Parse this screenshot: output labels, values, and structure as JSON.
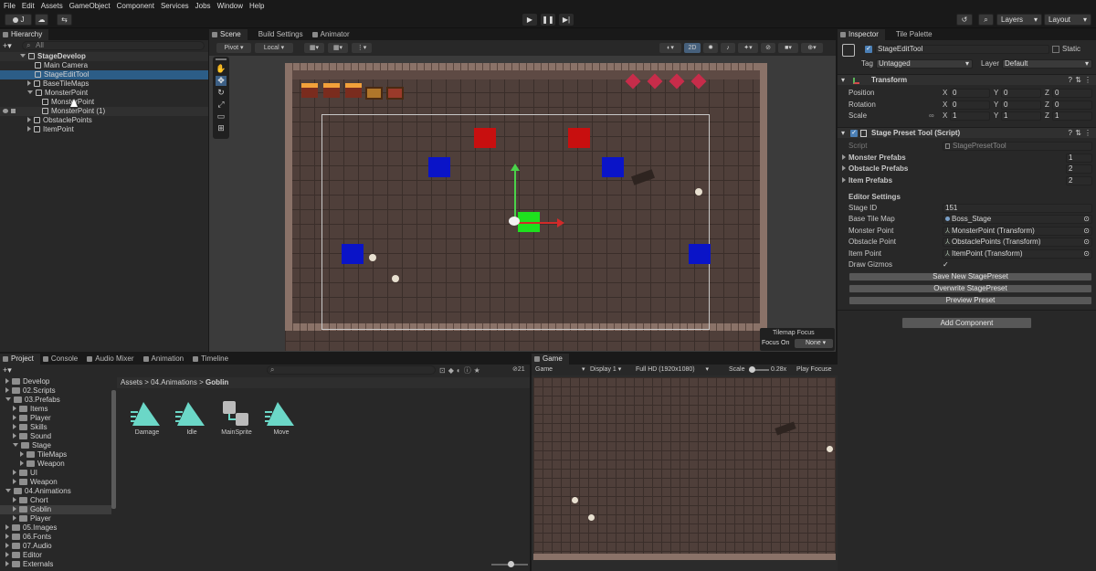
{
  "menu": [
    "File",
    "Edit",
    "Assets",
    "GameObject",
    "Component",
    "Services",
    "Jobs",
    "Window",
    "Help"
  ],
  "toolbar": {
    "account": "J",
    "layers": "Layers",
    "layout": "Layout"
  },
  "hierarchy": {
    "tab": "Hierarchy",
    "search_placeholder": "All",
    "scene": "StageDevelop",
    "items": [
      "Main Camera",
      "StageEditTool",
      "BaseTileMaps",
      "MonsterPoint",
      "MonsterPoint",
      "MonsterPoint (1)",
      "ObstaclePoints",
      "ItemPoint"
    ]
  },
  "scene_tabs": [
    "Scene",
    "Build Settings",
    "Animator"
  ],
  "scene_toolbar": {
    "pivot": "Pivot",
    "local": "Local",
    "mode2d": "2D"
  },
  "tilemap_focus": {
    "title": "Tilemap Focus",
    "label": "Focus On",
    "value": "None"
  },
  "inspector": {
    "tabs": [
      "Inspector",
      "Tile Palette"
    ],
    "object_name": "StageEditTool",
    "static_label": "Static",
    "tag_label": "Tag",
    "tag_value": "Untagged",
    "layer_label": "Layer",
    "layer_value": "Default",
    "transform": {
      "title": "Transform",
      "rows": [
        {
          "label": "Position",
          "x": "0",
          "y": "0",
          "z": "0"
        },
        {
          "label": "Rotation",
          "x": "0",
          "y": "0",
          "z": "0"
        },
        {
          "label": "Scale",
          "x": "1",
          "y": "1",
          "z": "1"
        }
      ]
    },
    "script_comp": {
      "title": "Stage Preset Tool (Script)",
      "script_label": "Script",
      "script_value": "StagePresetTool",
      "lists": [
        {
          "label": "Monster Prefabs",
          "value": "1"
        },
        {
          "label": "Obstacle Prefabs",
          "value": "2"
        },
        {
          "label": "Item Prefabs",
          "value": "2"
        }
      ],
      "editor_settings": "Editor Settings",
      "fields": [
        {
          "label": "Stage ID",
          "value": "151"
        },
        {
          "label": "Base Tile Map",
          "value": "Boss_Stage"
        },
        {
          "label": "Monster Point",
          "value": "MonsterPoint (Transform)"
        },
        {
          "label": "Obstacle Point",
          "value": "ObstaclePoints (Transform)"
        },
        {
          "label": "Item Point",
          "value": "ItemPoint (Transform)"
        },
        {
          "label": "Draw Gizmos",
          "value": "✓"
        }
      ],
      "buttons": [
        "Save New StagePreset",
        "Overwrite StagePreset",
        "Preview Preset"
      ]
    },
    "add_component": "Add Component"
  },
  "project": {
    "tabs": [
      "Project",
      "Console",
      "Audio Mixer",
      "Animation",
      "Timeline"
    ],
    "badge": "21",
    "tree": [
      {
        "t": "Develop",
        "d": 1,
        "o": 0
      },
      {
        "t": "02.Scripts",
        "d": 1,
        "o": 0
      },
      {
        "t": "03.Prefabs",
        "d": 1,
        "o": 1
      },
      {
        "t": "Items",
        "d": 2,
        "o": 0
      },
      {
        "t": "Player",
        "d": 2,
        "o": 0
      },
      {
        "t": "Skills",
        "d": 2,
        "o": 0
      },
      {
        "t": "Sound",
        "d": 2,
        "o": 0
      },
      {
        "t": "Stage",
        "d": 2,
        "o": 1
      },
      {
        "t": "TileMaps",
        "d": 3,
        "o": 0
      },
      {
        "t": "Weapon",
        "d": 3,
        "o": 0
      },
      {
        "t": "UI",
        "d": 2,
        "o": 0
      },
      {
        "t": "Weapon",
        "d": 2,
        "o": 0
      },
      {
        "t": "04.Animations",
        "d": 1,
        "o": 1
      },
      {
        "t": "Chort",
        "d": 2,
        "o": 0
      },
      {
        "t": "Goblin",
        "d": 2,
        "o": 0
      },
      {
        "t": "Player",
        "d": 2,
        "o": 0
      },
      {
        "t": "05.Images",
        "d": 1,
        "o": 0
      },
      {
        "t": "06.Fonts",
        "d": 1,
        "o": 0
      },
      {
        "t": "07.Audio",
        "d": 1,
        "o": 0
      },
      {
        "t": "Editor",
        "d": 1,
        "o": 0
      },
      {
        "t": "Externals",
        "d": 1,
        "o": 0
      }
    ],
    "breadcrumb": [
      "Assets",
      "04.Animations",
      "Goblin"
    ],
    "assets": [
      "Damage",
      "Idle",
      "MainSprite",
      "Move"
    ]
  },
  "game": {
    "tab": "Game",
    "display_mode": "Game",
    "display": "Display 1",
    "resolution": "Full HD (1920x1080)",
    "scale_label": "Scale",
    "scale_value": "0.28x",
    "play_focus": "Play Focuse"
  },
  "colors": {
    "selection": "#2c5d87",
    "dungeon_floor": "#4f3f3a",
    "red_block": "#c80f0f",
    "blue_block": "#0a14c8",
    "green_block": "#1ee01e"
  }
}
